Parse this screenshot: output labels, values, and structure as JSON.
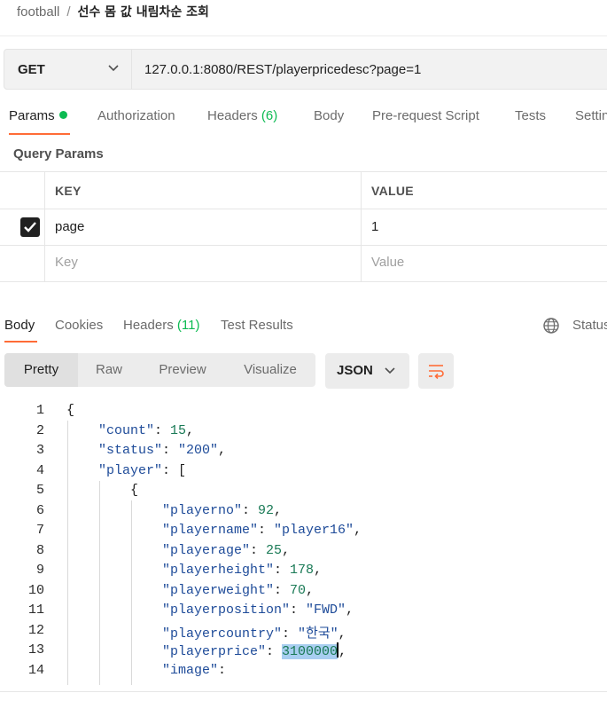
{
  "breadcrumb": {
    "workspace": "football",
    "separator": "/",
    "title": "선수 몸 값 내림차순 조회"
  },
  "request": {
    "method": "GET",
    "url": "127.0.0.1:8080/REST/playerpricedesc?page=1",
    "tabs": {
      "params": "Params",
      "authorization": "Authorization",
      "headers": "Headers",
      "headers_count": "(6)",
      "body": "Body",
      "prerequest": "Pre-request Script",
      "tests": "Tests",
      "settings": "Settin"
    },
    "query_params_title": "Query Params",
    "table": {
      "key_header": "KEY",
      "value_header": "VALUE",
      "rows": [
        {
          "key": "page",
          "value": "1",
          "checked": true
        }
      ],
      "placeholder_key": "Key",
      "placeholder_value": "Value"
    }
  },
  "response": {
    "tabs": {
      "body": "Body",
      "cookies": "Cookies",
      "headers": "Headers",
      "headers_count": "(11)",
      "test_results": "Test Results"
    },
    "status_label": "Status",
    "view_modes": [
      "Pretty",
      "Raw",
      "Preview",
      "Visualize"
    ],
    "format": "JSON",
    "code_lines": [
      {
        "n": "1"
      },
      {
        "n": "2"
      },
      {
        "n": "3"
      },
      {
        "n": "4"
      },
      {
        "n": "5"
      },
      {
        "n": "6"
      },
      {
        "n": "7"
      },
      {
        "n": "8"
      },
      {
        "n": "9"
      },
      {
        "n": "10"
      },
      {
        "n": "11"
      },
      {
        "n": "12"
      },
      {
        "n": "13"
      },
      {
        "n": "14"
      }
    ],
    "json": {
      "open_brace": "{",
      "count_key": "\"count\"",
      "count_val": "15",
      "status_key": "\"status\"",
      "status_val": "\"200\"",
      "player_key": "\"player\"",
      "open_bracket": "[",
      "obj_brace": "{",
      "playerno_key": "\"playerno\"",
      "playerno_val": "92",
      "playername_key": "\"playername\"",
      "playername_val": "\"player16\"",
      "playerage_key": "\"playerage\"",
      "playerage_val": "25",
      "playerheight_key": "\"playerheight\"",
      "playerheight_val": "178",
      "playerweight_key": "\"playerweight\"",
      "playerweight_val": "70",
      "playerposition_key": "\"playerposition\"",
      "playerposition_val": "\"FWD\"",
      "playercountry_key": "\"playercountry\"",
      "playercountry_val": "\"한국\"",
      "playerprice_key": "\"playerprice\"",
      "playerprice_val": "3100000",
      "image_key": "\"image\""
    }
  },
  "colors": {
    "accent": "#ff6c37",
    "green": "#0cbb52",
    "key_blue": "#1e4b99",
    "number_green": "#1a7a56"
  }
}
